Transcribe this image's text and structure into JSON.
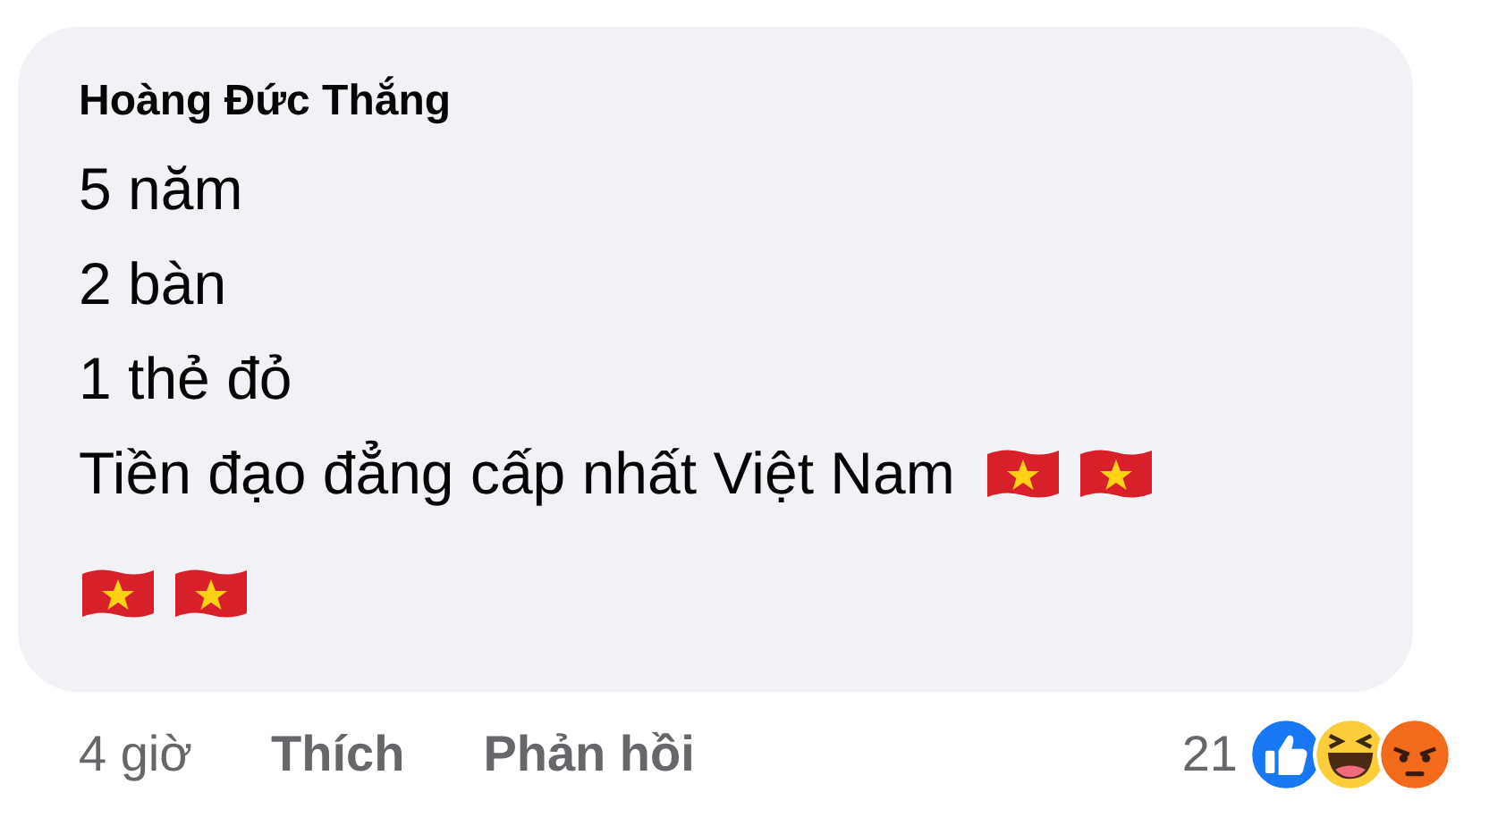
{
  "comment": {
    "author": "Hoàng Đức Thắng",
    "lines": [
      {
        "text": "5 năm"
      },
      {
        "text": "2 bàn"
      },
      {
        "text": "1 thẻ đỏ"
      },
      {
        "text": "Tiền đạo đẳng cấp nhất Việt Nam",
        "icons": [
          {
            "kind": "flag"
          },
          {
            "kind": "flag"
          }
        ]
      },
      {
        "icons": [
          {
            "kind": "flag"
          },
          {
            "kind": "flag"
          }
        ]
      }
    ]
  },
  "footer": {
    "time": "4 giờ",
    "actions": [
      "Thích",
      "Phản hồi"
    ],
    "reaction_count": "21",
    "reactions": [
      {
        "kind": "like"
      },
      {
        "kind": "haha"
      },
      {
        "kind": "angry"
      }
    ]
  }
}
